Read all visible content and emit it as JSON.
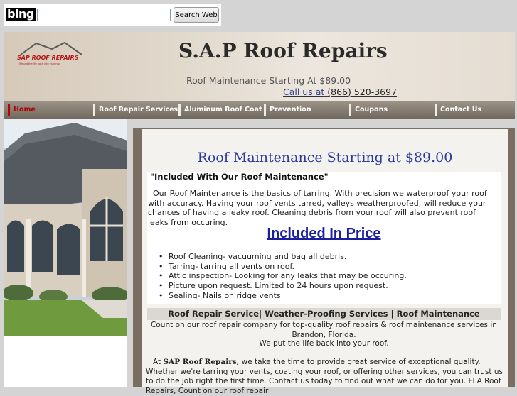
{
  "bing": {
    "logo_text": "bing",
    "search_value": "",
    "search_button": "Search Web"
  },
  "header": {
    "logo_text": "SAP ROOF REPAIRS",
    "logo_tagline": "We put the life back into your roof",
    "title": "S.A.P Roof Repairs",
    "tagline": "Roof Maintenance Starting At $89.00",
    "callus_label": "Call us at",
    "callus_phone": "(866) 520-3697"
  },
  "nav": {
    "items": [
      {
        "label": "Home",
        "active": true
      },
      {
        "label": "Roof Repair Services",
        "active": false
      },
      {
        "label": "Aluminum Roof Coat",
        "active": false
      },
      {
        "label": "Prevention",
        "active": false
      },
      {
        "label": "Coupons",
        "active": false
      },
      {
        "label": "Contact Us",
        "active": false
      }
    ]
  },
  "content": {
    "main_heading": "Roof Maintenance Starting at $89.00",
    "included_with": "\"Included With Our Roof Maintenance\"",
    "intro": "  Our Roof Maintenance is the basics of tarring. With precision we waterproof your roof with accuracy. Having your roof vents tarred, valleys weatherproofed, will reduce your chances of having a leaky roof. Cleaning debris from your roof will also prevent roof leaks from occuring.",
    "included_heading": "Included In Price",
    "included_items": [
      "Roof Cleaning-  vacuuming and bag all debris.",
      "Tarring- tarring all vents on roof.",
      "Attic inspection- Looking for any leaks that may be occuring.",
      "Picture upon request. Limited to 24 hours upon request.",
      "Sealing- Nails on ridge vents"
    ],
    "services_band": "Roof Repair Service| Weather-Proofing Services | Roof Maintenance",
    "count_on": "Count on our roof repair company for top-quality roof repairs & roof maintenance services in Brandon, Florida.",
    "life_back": "We put the life back into your roof.",
    "at_sap_prefix": "At ",
    "at_sap_bold": "SAP Roof Repairs,",
    "at_sap_rest": " we take the time to provide great service of exceptional quality. Whether we're tarring your vents, coating your roof, or offering other services, you can trust us to do the job right the first time. Contact us today to find out what we can do for you. FLA Roof Repairs, Count on our roof repair"
  },
  "colors": {
    "heading_blue": "#2b3a9e",
    "nav_active": "#b00000",
    "frame_brown": "#7a6e60"
  }
}
